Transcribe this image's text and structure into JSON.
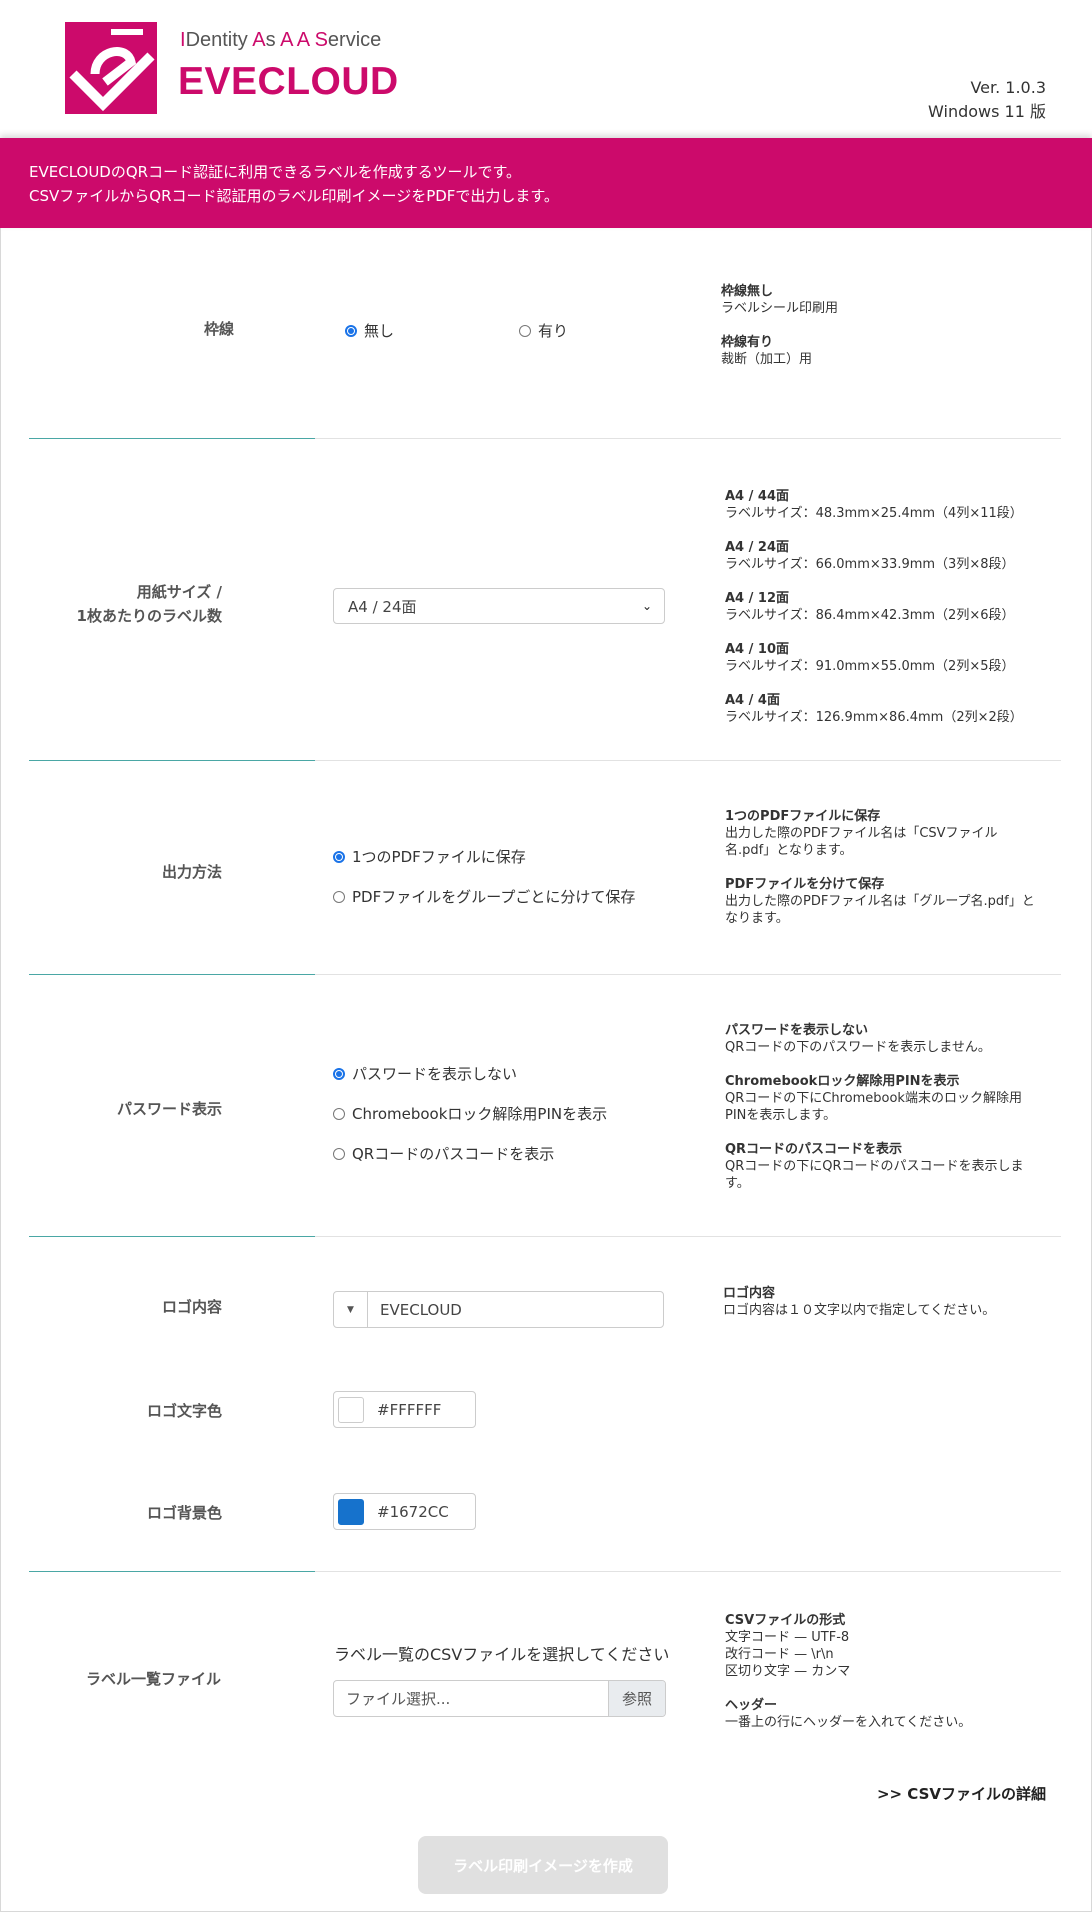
{
  "header": {
    "brand_line1": {
      "i": "I",
      "d": "Dentity ",
      "a1": "A",
      "s1": "s ",
      "a2": "A ",
      "a3": "A ",
      "s2": "S",
      "ervice": "ervice"
    },
    "brand_name": "EVECLOUD",
    "version": "Ver. 1.0.3",
    "platform": "Windows 11 版"
  },
  "banner": {
    "line1": "EVECLOUDのQRコード認証に利用できるラベルを作成するツールです。",
    "line2": "CSVファイルからQRコード認証用のラベル印刷イメージをPDFで出力します。"
  },
  "border": {
    "label": "枠線",
    "options": [
      "無し",
      "有り"
    ],
    "selected": 0,
    "desc": [
      {
        "title": "枠線無し",
        "text": "ラベルシール印刷用"
      },
      {
        "title": "枠線有り",
        "text": "裁断（加工）用"
      }
    ]
  },
  "paper": {
    "label_line1": "用紙サイズ /",
    "label_line2": "1枚あたりのラベル数",
    "selected": "A4 / 24面",
    "desc": [
      {
        "title": "A4 / 44面",
        "text": "ラベルサイズ：48.3mm×25.4mm（4列×11段）"
      },
      {
        "title": "A4 / 24面",
        "text": "ラベルサイズ：66.0mm×33.9mm（3列×8段）"
      },
      {
        "title": "A4 / 12面",
        "text": "ラベルサイズ：86.4mm×42.3mm（2列×6段）"
      },
      {
        "title": "A4 / 10面",
        "text": "ラベルサイズ：91.0mm×55.0mm（2列×5段）"
      },
      {
        "title": "A4 / 4面",
        "text": "ラベルサイズ：126.9mm×86.4mm（2列×2段）"
      }
    ]
  },
  "output": {
    "label": "出力方法",
    "options": [
      "1つのPDFファイルに保存",
      "PDFファイルをグループごとに分けて保存"
    ],
    "selected": 0,
    "desc": [
      {
        "title": "1つのPDFファイルに保存",
        "text1": "出力した際のPDFファイル名は「CSVファイル",
        "text2": "名.pdf」となります。"
      },
      {
        "title": "PDFファイルを分けて保存",
        "text1": "出力した際のPDFファイル名は「グループ名.pdf」と",
        "text2": "なります。"
      }
    ]
  },
  "password": {
    "label": "パスワード表示",
    "options": [
      "パスワードを表示しない",
      "Chromebookロック解除用PINを表示",
      "QRコードのパスコードを表示"
    ],
    "selected": 0,
    "desc": [
      {
        "title": "パスワードを表示しない",
        "text1": "QRコードの下のパスワードを表示しません。",
        "text2": ""
      },
      {
        "title": "Chromebookロック解除用PINを表示",
        "text1": "QRコードの下にChromebook端末のロック解除用",
        "text2": "PINを表示します。"
      },
      {
        "title": "QRコードのパスコードを表示",
        "text1": "QRコードの下にQRコードのパスコードを表示しま",
        "text2": "す。"
      }
    ]
  },
  "logo": {
    "content_label": "ロゴ内容",
    "content_value": "EVECLOUD",
    "desc_title": "ロゴ内容",
    "desc_text": "ロゴ内容は１０文字以内で指定してください。",
    "text_color_label": "ロゴ文字色",
    "text_color": "#FFFFFF",
    "bg_color_label": "ロゴ背景色",
    "bg_color": "#1672CC"
  },
  "file": {
    "label": "ラベル一覧ファイル",
    "prompt": "ラベル一覧のCSVファイルを選択してください",
    "placeholder": "ファイル選択...",
    "browse": "参照",
    "desc": [
      {
        "title": "CSVファイルの形式",
        "lines": [
          "文字コード — UTF-8",
          "改行コード — \\r\\n",
          "区切り文字 — カンマ"
        ]
      },
      {
        "title": "ヘッダー",
        "lines": [
          "一番上の行にヘッダーを入れてください。"
        ]
      }
    ],
    "details_link": ">> CSVファイルの詳細"
  },
  "submit": "ラベル印刷イメージを作成",
  "colors": {
    "brand": "#cc0a6b",
    "accent_line": "#4aa7a5",
    "radio": "#1a73e8"
  }
}
